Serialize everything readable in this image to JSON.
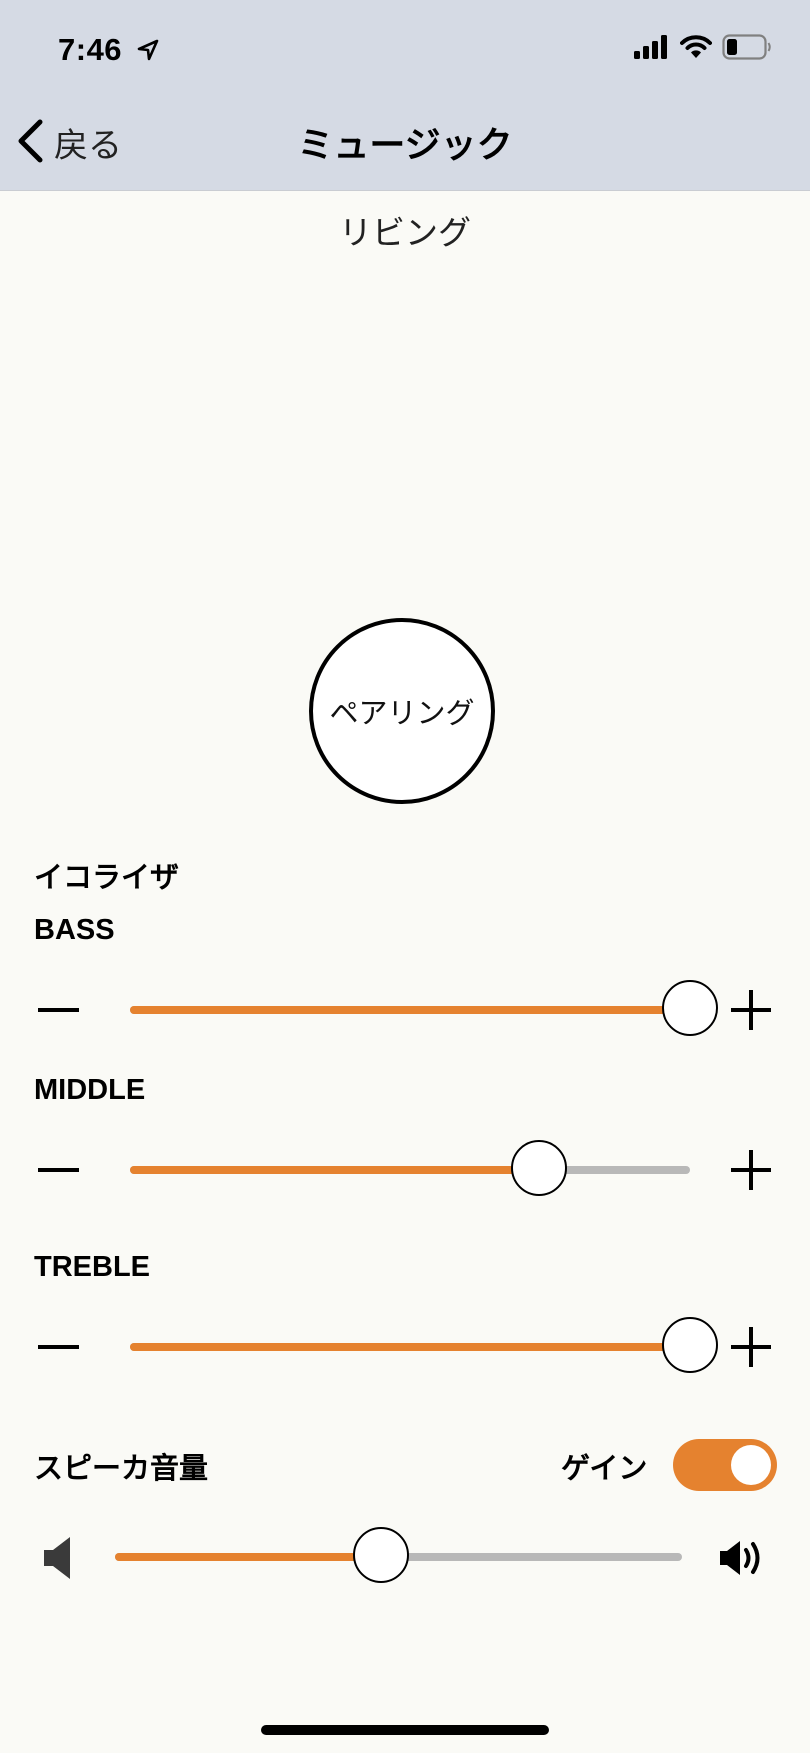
{
  "status_bar": {
    "time": "7:46",
    "location_icon": "location-arrow-icon",
    "signal_icon": "cellular-signal-icon",
    "wifi_icon": "wifi-icon",
    "battery_icon": "battery-icon",
    "battery_level": 0.25
  },
  "nav": {
    "back_label": "戻る",
    "title": "ミュージック"
  },
  "room_name": "リビング",
  "pair_button_label": "ペアリング",
  "equalizer": {
    "title": "イコライザ",
    "bands": [
      {
        "label": "BASS",
        "value": 1.0
      },
      {
        "label": "MIDDLE",
        "value": 0.73
      },
      {
        "label": "TREBLE",
        "value": 1.0
      }
    ]
  },
  "speaker_volume": {
    "title": "スピーカ音量",
    "gain_label": "ゲイン",
    "gain_on": true,
    "value": 0.47
  },
  "colors": {
    "accent": "#e5822f",
    "track_inactive": "#b8b8b8",
    "header_bg": "#d5dae4",
    "page_bg": "#fafaf6"
  }
}
